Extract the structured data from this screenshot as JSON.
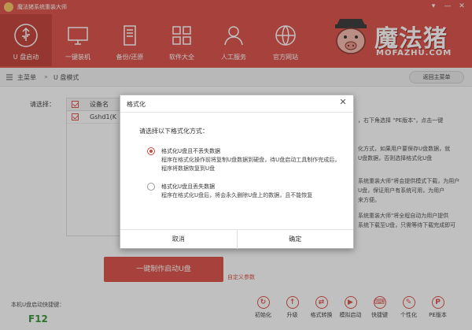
{
  "window": {
    "title": "魔法猪系统重装大师",
    "controls": [
      "▾",
      "—",
      "✕"
    ]
  },
  "nav": {
    "items": [
      {
        "label": "U 盘启动",
        "icon": "usb-icon",
        "active": true
      },
      {
        "label": "一键装机",
        "icon": "monitor-icon",
        "active": false
      },
      {
        "label": "备份/还原",
        "icon": "server-icon",
        "active": false
      },
      {
        "label": "软件大全",
        "icon": "grid-icon",
        "active": false
      },
      {
        "label": "人工服务",
        "icon": "person-icon",
        "active": false
      },
      {
        "label": "官方网站",
        "icon": "globe-icon",
        "active": false
      }
    ]
  },
  "brand": {
    "name": "魔法猪",
    "sub": "MOFAZHU.COM"
  },
  "breadcrumb": {
    "home": "主菜单",
    "separator": "»",
    "current": "U 盘模式",
    "back_label": "返回主菜单"
  },
  "main": {
    "select_label": "请选择：",
    "table": {
      "header": "设备名",
      "rows": [
        "Gshd1(K"
      ]
    },
    "right_text": [
      "，右下角选择 \"PE版本\"，点击一键",
      "化方式，如果用户要保存U盘数据，就",
      "U盘数据，否则选择格式化U盘",
      "系统重装大师\"将会提供模式下载，为用户",
      "U盘，保证用户有系统可用，为用户",
      "来方便。",
      "系统重装大师\"将全程自动为用户提供",
      "系统下载至U盘，只需等待下载完成即可"
    ],
    "make_button": "一键制作启动U盘",
    "custom_link": "自定义参数",
    "hotkey_label": "本机U盘启动快捷键：",
    "hotkey_value": "F12"
  },
  "tools": [
    {
      "label": "初始化",
      "icon": "refresh-icon",
      "glyph": "↻"
    },
    {
      "label": "升级",
      "icon": "upgrade-icon",
      "glyph": "↑"
    },
    {
      "label": "格式转换",
      "icon": "convert-icon",
      "glyph": "⇄"
    },
    {
      "label": "模拟启动",
      "icon": "simulate-icon",
      "glyph": "▶"
    },
    {
      "label": "快捷键",
      "icon": "keyboard-icon",
      "glyph": "⌨"
    },
    {
      "label": "个性化",
      "icon": "personalize-icon",
      "glyph": "✎"
    },
    {
      "label": "PE版本",
      "icon": "pe-icon",
      "glyph": "P"
    }
  ],
  "dialog": {
    "title": "格式化",
    "close": "✕",
    "prompt": "请选择以下格式化方式：",
    "options": [
      {
        "title": "格式化U盘且不丢失数据",
        "desc": "程序在格式化操作前将复制U盘数据到硬盘，待U盘启动工具制作完成后，程序将数据恢复到U盘",
        "selected": true
      },
      {
        "title": "格式化U盘且丢失数据",
        "desc": "程序在格式化U盘后，将会永久删除U盘上的数据，且不能恢复",
        "selected": false
      }
    ],
    "cancel": "取消",
    "ok": "确定"
  },
  "colors": {
    "accent": "#d9463b",
    "nav_active": "#c0352c",
    "hotkey": "#2a8c2a"
  }
}
